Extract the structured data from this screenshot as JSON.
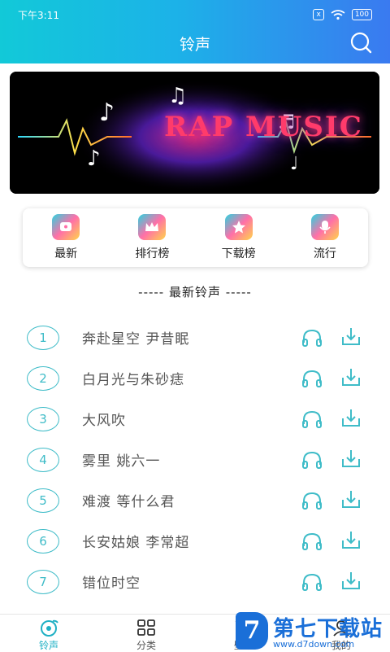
{
  "status_bar": {
    "time": "下午3:11",
    "sim_badge": "x",
    "battery": "100"
  },
  "header": {
    "title": "铃声"
  },
  "banner": {
    "text": "RAP MUSIC"
  },
  "categories": [
    {
      "label": "最新",
      "icon": "ringtone-new-icon"
    },
    {
      "label": "排行榜",
      "icon": "crown-icon"
    },
    {
      "label": "下载榜",
      "icon": "star-icon"
    },
    {
      "label": "流行",
      "icon": "mic-icon"
    }
  ],
  "section": {
    "title": "-----  最新铃声  -----"
  },
  "songs": [
    {
      "num": "1",
      "title": "奔赴星空 尹昔眠"
    },
    {
      "num": "2",
      "title": "白月光与朱砂痣"
    },
    {
      "num": "3",
      "title": "大风吹"
    },
    {
      "num": "4",
      "title": "雾里 姚六一"
    },
    {
      "num": "5",
      "title": "难渡 等什么君"
    },
    {
      "num": "6",
      "title": "长安姑娘 李常超"
    },
    {
      "num": "7",
      "title": "错位时空"
    }
  ],
  "tabs": [
    {
      "label": "铃声"
    },
    {
      "label": "分类"
    },
    {
      "label": "壁纸"
    },
    {
      "label": "我的"
    }
  ],
  "watermark": {
    "logo": "7",
    "title": "第七下载站",
    "url": "www.d7down.com"
  },
  "colors": {
    "accent": "#1fb0c4",
    "header_start": "#12c9d8",
    "header_end": "#3a7af0"
  }
}
